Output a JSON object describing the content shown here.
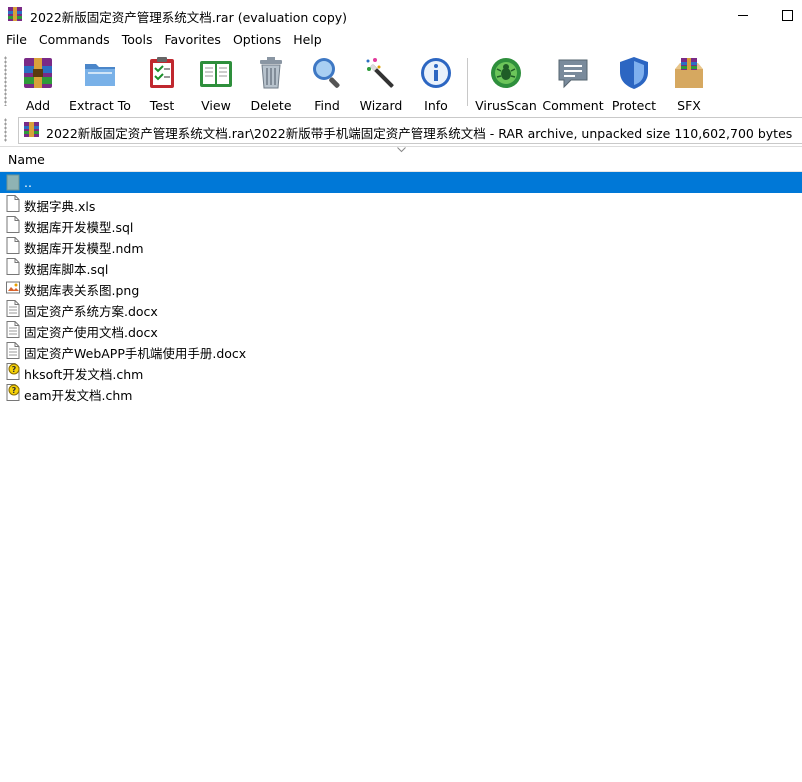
{
  "window": {
    "title": "2022新版固定资产管理系统文档.rar (evaluation copy)"
  },
  "menu": [
    "File",
    "Commands",
    "Tools",
    "Favorites",
    "Options",
    "Help"
  ],
  "toolbar": {
    "buttons": [
      {
        "label": "Add",
        "icon": "archive-add-icon"
      },
      {
        "label": "Extract To",
        "icon": "folder-extract-icon"
      },
      {
        "label": "Test",
        "icon": "clipboard-test-icon"
      },
      {
        "label": "View",
        "icon": "book-view-icon"
      },
      {
        "label": "Delete",
        "icon": "trash-icon"
      },
      {
        "label": "Find",
        "icon": "magnifier-icon"
      },
      {
        "label": "Wizard",
        "icon": "magic-wand-icon"
      },
      {
        "label": "Info",
        "icon": "info-icon"
      },
      {
        "label": "VirusScan",
        "icon": "virus-scan-icon"
      },
      {
        "label": "Comment",
        "icon": "comment-icon"
      },
      {
        "label": "Protect",
        "icon": "shield-icon"
      },
      {
        "label": "SFX",
        "icon": "sfx-box-icon"
      }
    ]
  },
  "address": {
    "path": "2022新版固定资产管理系统文档.rar\\2022新版带手机端固定资产管理系统文档 - RAR archive, unpacked size 110,602,700 bytes"
  },
  "list": {
    "column_name": "Name",
    "files": [
      {
        "name": "..",
        "type": "parent",
        "selected": true
      },
      {
        "name": "数据字典.xls",
        "type": "file"
      },
      {
        "name": "数据库开发模型.sql",
        "type": "file"
      },
      {
        "name": "数据库开发模型.ndm",
        "type": "file"
      },
      {
        "name": "数据库脚本.sql",
        "type": "file"
      },
      {
        "name": "数据库表关系图.png",
        "type": "image"
      },
      {
        "name": "固定资产系统方案.docx",
        "type": "doc"
      },
      {
        "name": "固定资产使用文档.docx",
        "type": "doc"
      },
      {
        "name": "固定资产WebAPP手机端使用手册.docx",
        "type": "doc"
      },
      {
        "name": "hksoft开发文档.chm",
        "type": "chm"
      },
      {
        "name": "eam开发文档.chm",
        "type": "chm"
      }
    ]
  },
  "colors": {
    "selection": "#0078d7",
    "background": "#ffffff"
  }
}
